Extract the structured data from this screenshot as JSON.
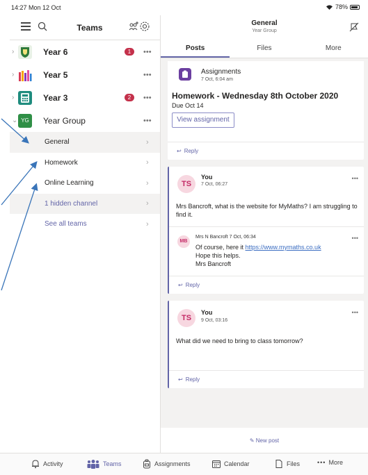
{
  "status": {
    "time": "14:27  Mon 12 Oct",
    "battery": "78%"
  },
  "sidebar": {
    "title": "Teams",
    "teams": [
      {
        "name": "Year 6",
        "bold": true,
        "badge": "1",
        "color": "#2f7a3a"
      },
      {
        "name": "Year 5",
        "bold": true,
        "badge": "",
        "color": "#d83b57"
      },
      {
        "name": "Year 3",
        "bold": true,
        "badge": "2",
        "color": "#1f8c7e"
      },
      {
        "name": "Year Group",
        "bold": false,
        "badge": "",
        "color": "#2f8f46",
        "avatar_text": "YG"
      }
    ],
    "channels": [
      {
        "label": "General",
        "selected": true
      },
      {
        "label": "Homework",
        "selected": false
      },
      {
        "label": "Online Learning",
        "selected": false
      },
      {
        "label": "1 hidden channel",
        "selected": true
      },
      {
        "label": "See all teams",
        "selected": false
      }
    ]
  },
  "channel": {
    "title": "General",
    "subtitle": "Year Group",
    "tabs": [
      "Posts",
      "Files",
      "More"
    ]
  },
  "posts": {
    "assignment": {
      "app": "Assignments",
      "time": "7 Oct, 6:04 am",
      "title": "Homework - Wednesday 8th October 2020",
      "due": "Due Oct 14",
      "button": "View assignment",
      "reply": "Reply"
    },
    "post1": {
      "initials": "TS",
      "author": "You",
      "time": "7 Oct, 06:27",
      "text": "Mrs Bancroft, what is the website for MyMaths? I am struggling to find it.",
      "reply_initials": "MB",
      "reply_author": "Mrs N Bancroft 7 Oct, 06:34",
      "reply_text_1": "Of course, here it ",
      "reply_link": "https://www.mymaths.co.uk",
      "reply_text_2": "Hope this helps.",
      "reply_text_3": "Mrs Bancroft",
      "reply": "Reply"
    },
    "post2": {
      "initials": "TS",
      "author": "You",
      "time": "9 Oct, 03:16",
      "text": "What did we need to bring to class tomorrow?",
      "reply": "Reply"
    },
    "new_post": "New post"
  },
  "bottom_nav": [
    "Activity",
    "Teams",
    "Assignments",
    "Calendar",
    "Files",
    "More"
  ],
  "colors": {
    "accent": "#6264a7",
    "badge": "#c4314b",
    "arrow": "#3a75b9"
  }
}
